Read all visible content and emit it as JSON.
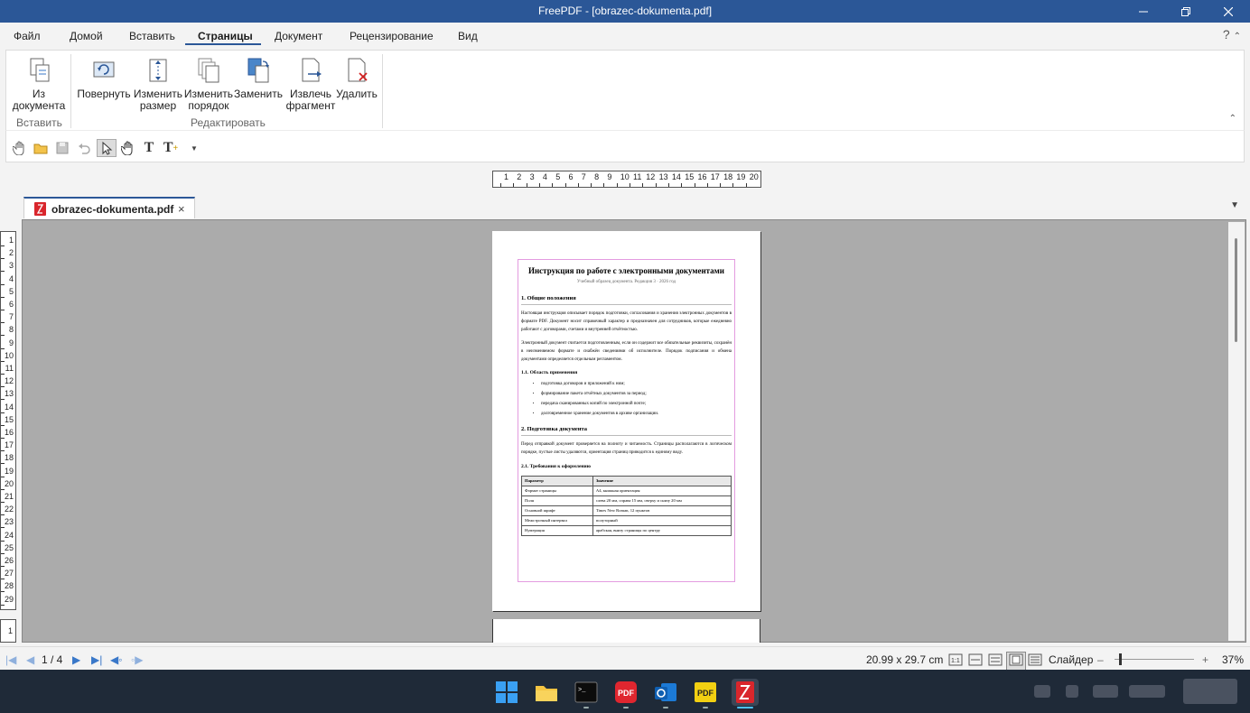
{
  "app": {
    "title": "FreePDF - [obrazec-dokumenta.pdf]"
  },
  "menu": {
    "file": "Файл",
    "home": "Домой",
    "insert": "Вставить",
    "pages": "Страницы",
    "document": "Документ",
    "review": "Рецензирование",
    "view": "Вид",
    "help": "?"
  },
  "ribbon": {
    "from_doc_l1": "Из",
    "from_doc_l2": "документа",
    "rotate": "Повернуть",
    "resize_l1": "Изменить",
    "resize_l2": "размер",
    "reorder_l1": "Изменить",
    "reorder_l2": "порядок",
    "replace": "Заменить",
    "extract_l1": "Извлечь",
    "extract_l2": "фрагмент",
    "delete": "Удалить",
    "group_insert": "Вставить",
    "group_edit": "Редактировать"
  },
  "ruler": {
    "h": [
      "1",
      "2",
      "3",
      "4",
      "5",
      "6",
      "7",
      "8",
      "9",
      "10",
      "11",
      "12",
      "13",
      "14",
      "15",
      "16",
      "17",
      "18",
      "19",
      "20"
    ],
    "v": [
      "1",
      "2",
      "3",
      "4",
      "5",
      "6",
      "7",
      "8",
      "9",
      "10",
      "11",
      "12",
      "13",
      "14",
      "15",
      "16",
      "17",
      "18",
      "19",
      "20",
      "21",
      "22",
      "23",
      "24",
      "25",
      "26",
      "27",
      "28",
      "29"
    ],
    "v2": "1"
  },
  "tab": {
    "filename": "obrazec-dokumenta.pdf",
    "close": "×"
  },
  "doc": {
    "title": "Инструкция по работе с электронными документами",
    "subtitle": "Учебный образец документа. Редакция 3 · 2026 год",
    "s1": "1. Общие положения",
    "p1": "Настоящая инструкция описывает порядок подготовки, согласования и хранения электронных документов в формате PDF. Документ носит справочный характер и предназначен для сотрудников, которые ежедневно работают с договорами, счетами и внутренней отчётностью.",
    "p2": "Электронный документ считается подготовленным, если он содержит все обязательные реквизиты, сохранён в неизменяемом формате и снабжён сведениями об исполнителе. Порядок подписания и обмена документами определяется отдельным регламентом.",
    "s11": "1.1. Область применения",
    "bullets": [
      "подготовка договоров и приложений к ним;",
      "формирование пакета отчётных документов за период;",
      "передача сканированных копий по электронной почте;",
      "долговременное хранение документов в архиве организации."
    ],
    "s2": "2. Подготовка документа",
    "p3": "Перед отправкой документ проверяется на полноту и читаемость. Страницы располагаются в логическом порядке, пустые листы удаляются, ориентация страниц приводится к единому виду.",
    "s21": "2.1. Требования к оформлению",
    "table": {
      "headers": [
        "Параметр",
        "Значение"
      ],
      "rows": [
        [
          "Формат страницы",
          "А4, книжная ориентация"
        ],
        [
          "Поля",
          "слева 20 мм, справа 15 мм, сверху и снизу 20 мм"
        ],
        [
          "Основной шрифт",
          "Times New Roman, 12 пунктов"
        ],
        [
          "Межстрочный интервал",
          "полуторный"
        ],
        [
          "Нумерация",
          "арабская, внизу страницы по центру"
        ]
      ]
    }
  },
  "status": {
    "page": "1 / 4",
    "size": "20.99 x 29.7 cm",
    "slider": "Слайдер",
    "zoom": "37%",
    "zoom_level": 0.37
  }
}
